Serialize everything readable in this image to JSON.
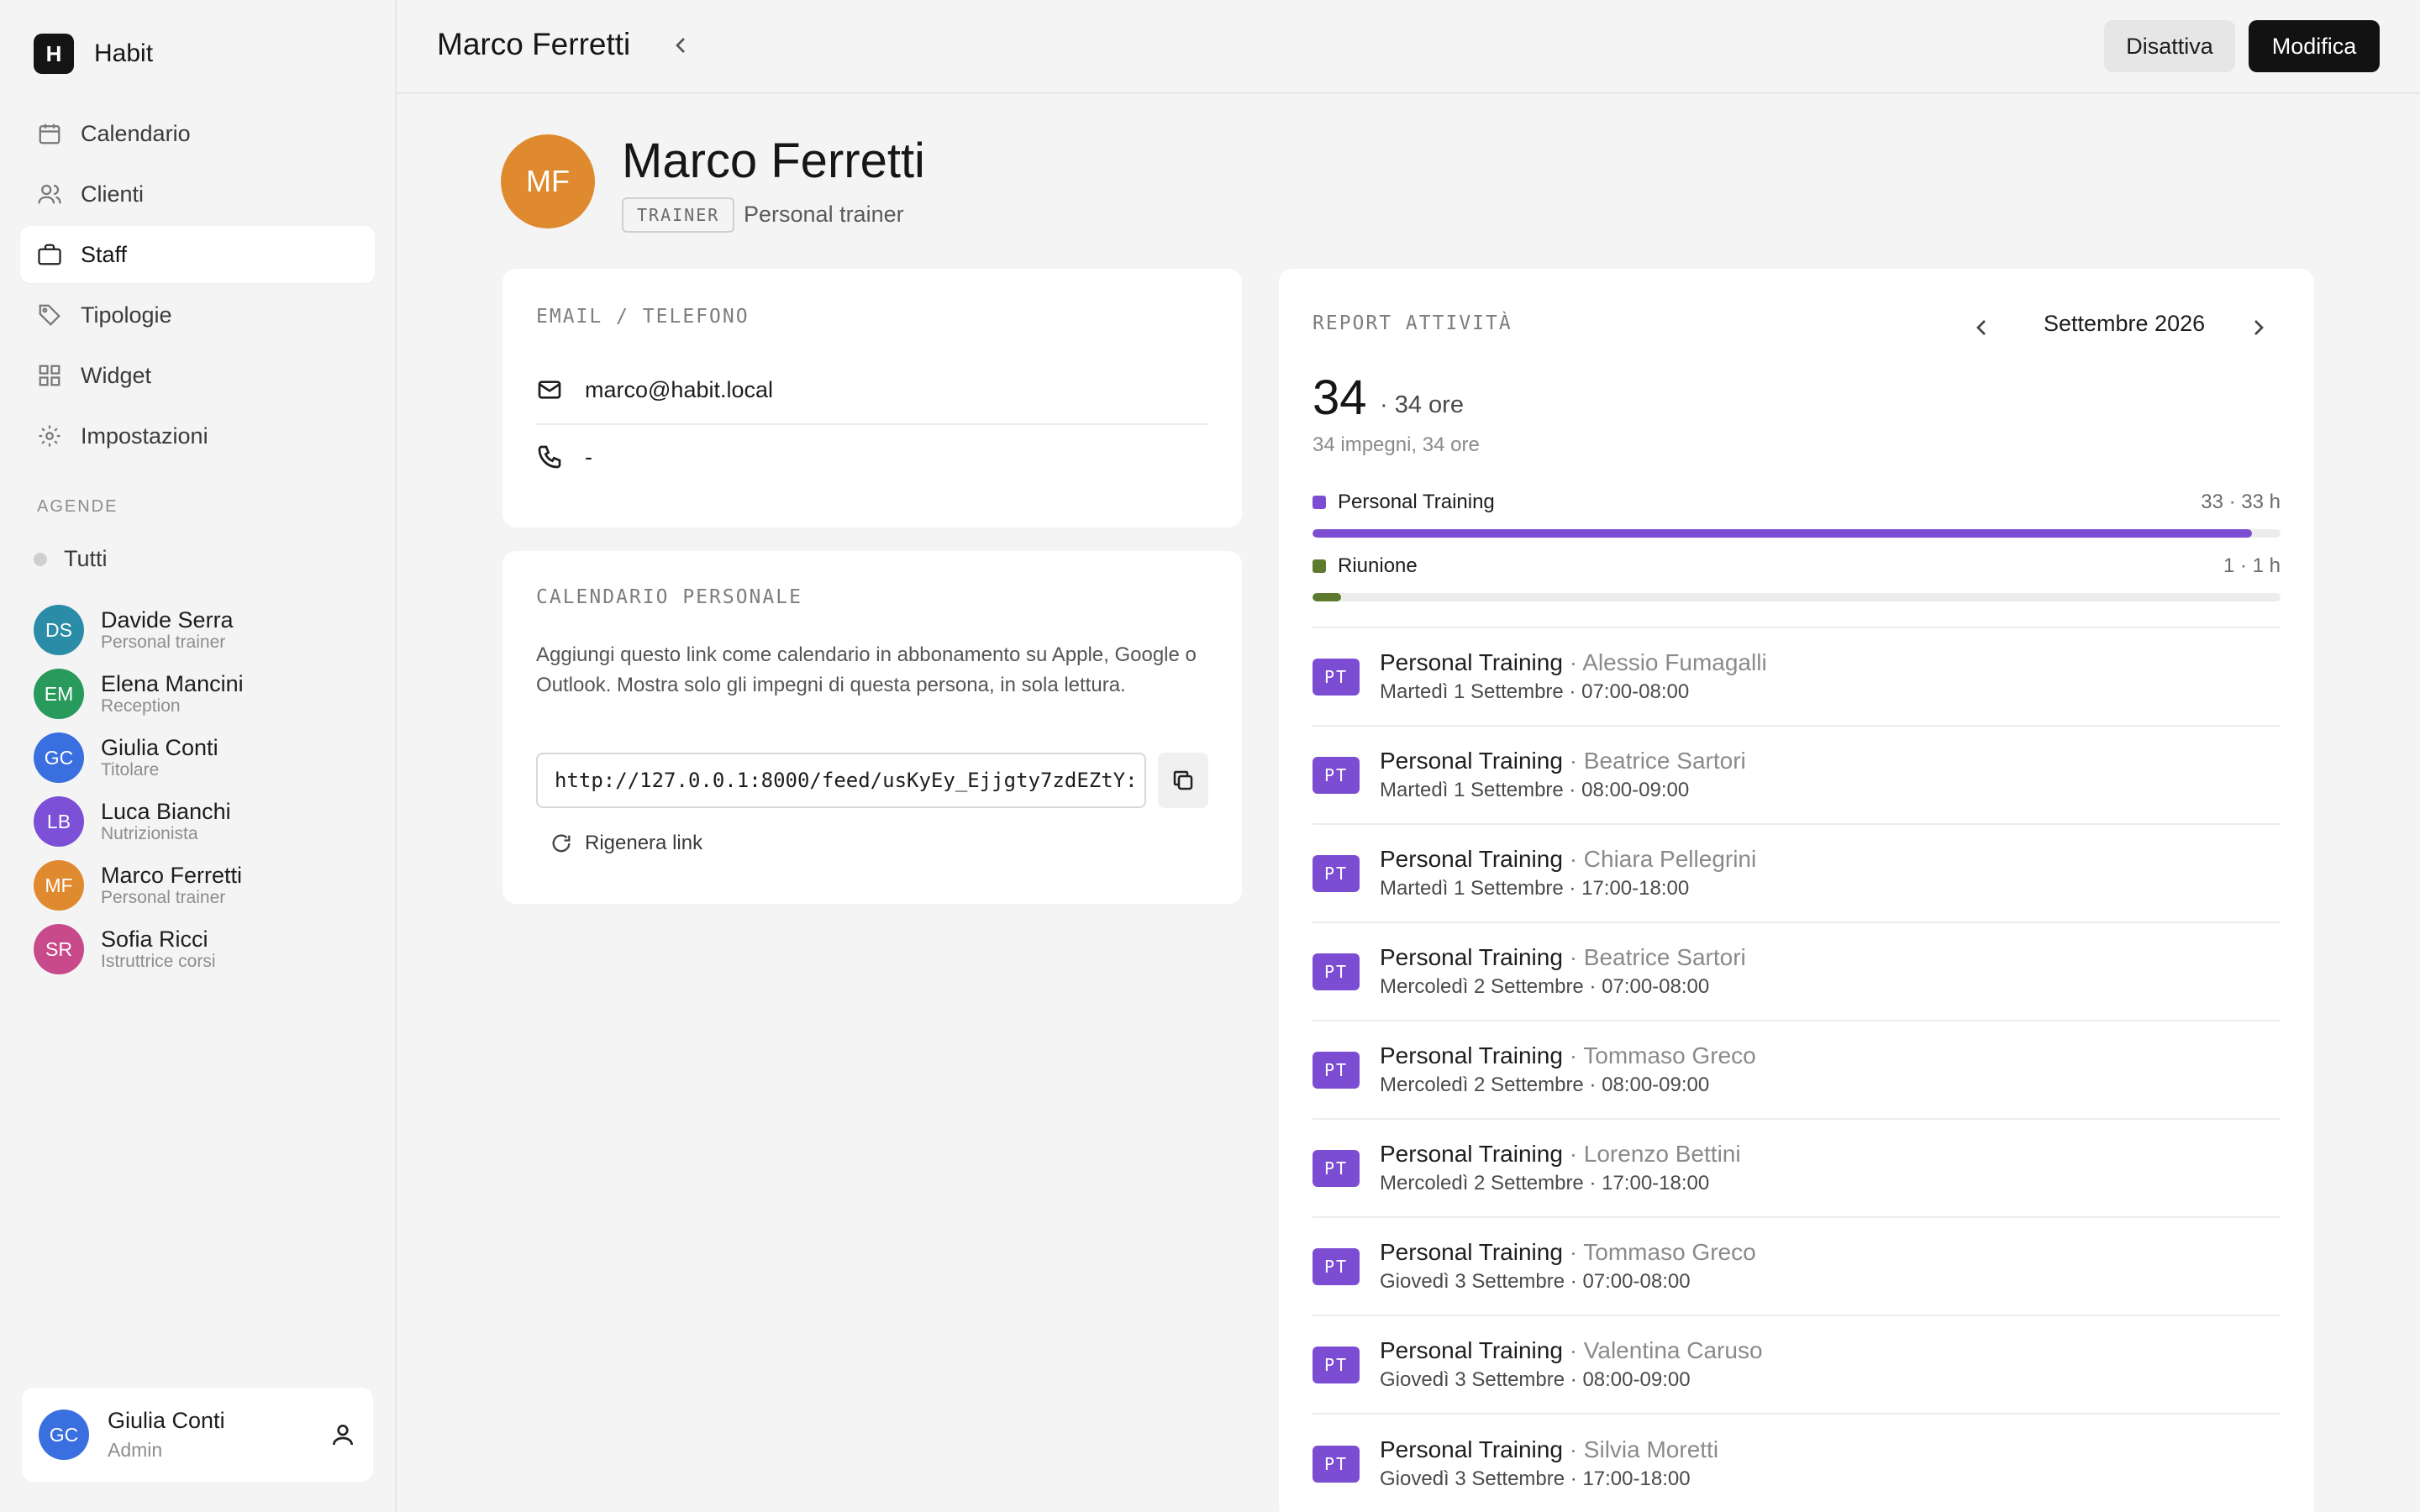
{
  "app": {
    "logo_letter": "H",
    "name": "Habit"
  },
  "sidebar": {
    "nav": [
      {
        "label": "Calendario",
        "icon": "calendar-icon"
      },
      {
        "label": "Clienti",
        "icon": "users-icon"
      },
      {
        "label": "Staff",
        "icon": "briefcase-icon",
        "active": true
      },
      {
        "label": "Tipologie",
        "icon": "tag-icon"
      },
      {
        "label": "Widget",
        "icon": "grid-icon"
      },
      {
        "label": "Impostazioni",
        "icon": "gear-icon"
      }
    ],
    "section_label": "AGENDE",
    "all_label": "Tutti",
    "staff": [
      {
        "initials": "DS",
        "name": "Davide Serra",
        "role": "Personal trainer",
        "color": "#2b8ca8"
      },
      {
        "initials": "EM",
        "name": "Elena Mancini",
        "role": "Reception",
        "color": "#279a5c"
      },
      {
        "initials": "GC",
        "name": "Giulia Conti",
        "role": "Titolare",
        "color": "#3a6fe0"
      },
      {
        "initials": "LB",
        "name": "Luca Bianchi",
        "role": "Nutrizionista",
        "color": "#7b4fd6"
      },
      {
        "initials": "MF",
        "name": "Marco Ferretti",
        "role": "Personal trainer",
        "color": "#e08a30"
      },
      {
        "initials": "SR",
        "name": "Sofia Ricci",
        "role": "Istruttrice corsi",
        "color": "#c94a8a"
      }
    ],
    "user": {
      "initials": "GC",
      "name": "Giulia Conti",
      "role": "Admin",
      "color": "#3a6fe0"
    }
  },
  "topbar": {
    "title": "Marco Ferretti",
    "deactivate_label": "Disattiva",
    "edit_label": "Modifica"
  },
  "profile": {
    "initials": "MF",
    "name": "Marco Ferretti",
    "badge": "TRAINER",
    "role": "Personal trainer"
  },
  "contact": {
    "label": "EMAIL / TELEFONO",
    "email": "marco@habit.local",
    "phone": "-"
  },
  "calendar": {
    "label": "CALENDARIO PERSONALE",
    "description": "Aggiungi questo link come calendario in abbonamento su Apple, Google o Outlook. Mostra solo gli impegni di questa persona, in sola lettura.",
    "feed_url": "http://127.0.0.1:8000/feed/usKyEy_Ejjgty7zdEZtY:",
    "regen_label": "Rigenera link"
  },
  "report": {
    "label": "REPORT ATTIVITÀ",
    "month": "Settembre 2026",
    "total": "34",
    "total_hours": "· 34 ore",
    "subtitle": "34 impegni, 34 ore",
    "breakdown": [
      {
        "name": "Personal Training",
        "meta": "33 · 33 h",
        "fraction": 0.9706,
        "color": "#7c4dd2"
      },
      {
        "name": "Riunione",
        "meta": "1 · 1 h",
        "fraction": 0.0294,
        "color": "#5e7a2e"
      }
    ],
    "events": [
      {
        "badge": "PT",
        "type": "Personal Training",
        "client": "· Alessio Fumagalli",
        "when": "Martedì 1 Settembre · 07:00-08:00"
      },
      {
        "badge": "PT",
        "type": "Personal Training",
        "client": "· Beatrice Sartori",
        "when": "Martedì 1 Settembre · 08:00-09:00"
      },
      {
        "badge": "PT",
        "type": "Personal Training",
        "client": "· Chiara Pellegrini",
        "when": "Martedì 1 Settembre · 17:00-18:00"
      },
      {
        "badge": "PT",
        "type": "Personal Training",
        "client": "· Beatrice Sartori",
        "when": "Mercoledì 2 Settembre · 07:00-08:00"
      },
      {
        "badge": "PT",
        "type": "Personal Training",
        "client": "· Tommaso Greco",
        "when": "Mercoledì 2 Settembre · 08:00-09:00"
      },
      {
        "badge": "PT",
        "type": "Personal Training",
        "client": "· Lorenzo Bettini",
        "when": "Mercoledì 2 Settembre · 17:00-18:00"
      },
      {
        "badge": "PT",
        "type": "Personal Training",
        "client": "· Tommaso Greco",
        "when": "Giovedì 3 Settembre · 07:00-08:00"
      },
      {
        "badge": "PT",
        "type": "Personal Training",
        "client": "· Valentina Caruso",
        "when": "Giovedì 3 Settembre · 08:00-09:00"
      },
      {
        "badge": "PT",
        "type": "Personal Training",
        "client": "· Silvia Moretti",
        "when": "Giovedì 3 Settembre · 17:00-18:00"
      }
    ]
  }
}
